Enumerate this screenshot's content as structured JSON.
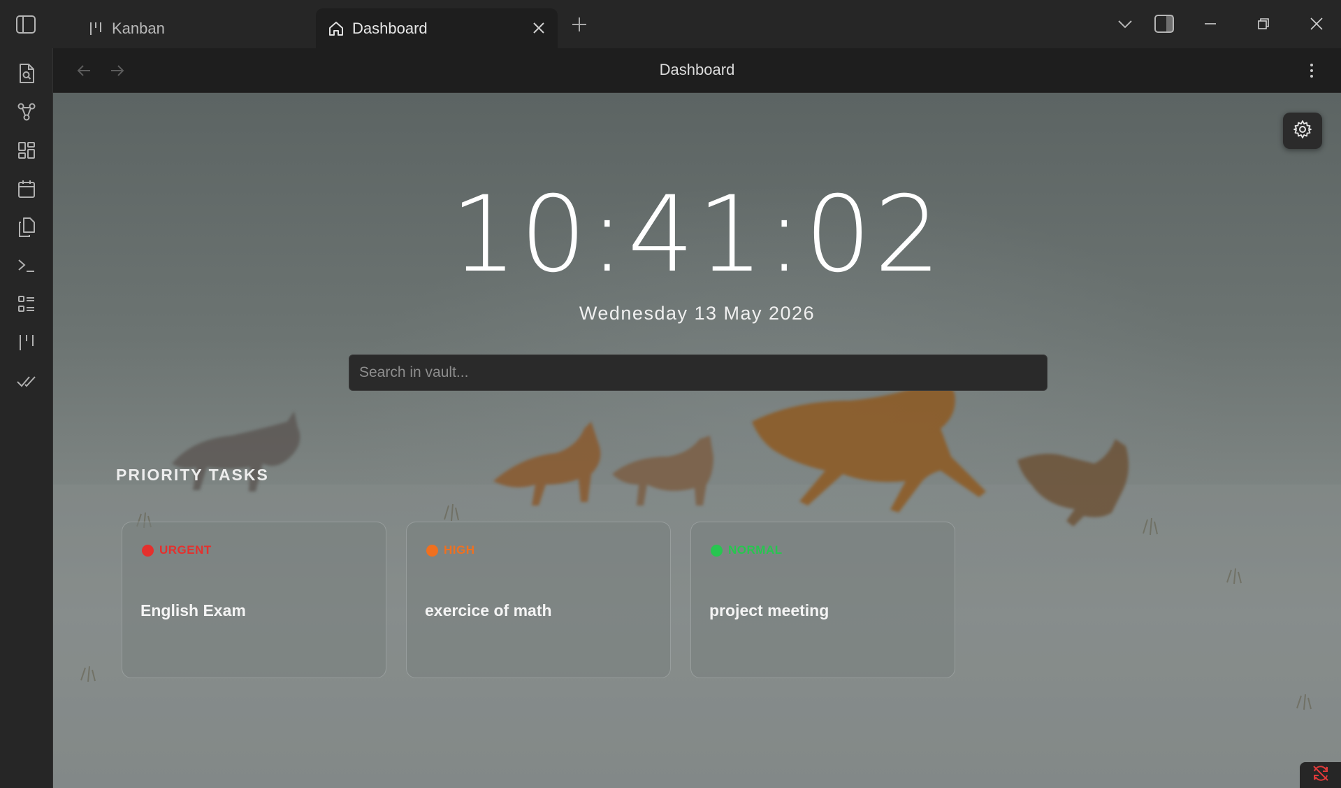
{
  "titlebar": {
    "tabs": [
      {
        "label": "Kanban",
        "icon": "kanban-icon",
        "active": false
      },
      {
        "label": "Dashboard",
        "icon": "home-icon",
        "active": true
      }
    ]
  },
  "ribbon": {
    "items": [
      "file-search-icon",
      "graph-icon",
      "grid-icon",
      "calendar-icon",
      "copy-icon",
      "terminal-icon",
      "list-icon",
      "kanban-icon",
      "check-icon"
    ]
  },
  "header": {
    "title": "Dashboard"
  },
  "dashboard": {
    "clock": "10:41:02",
    "date": "Wednesday 13 May 2026",
    "search_placeholder": "Search in vault...",
    "section_title": "PRIORITY TASKS",
    "tasks": [
      {
        "priority": "URGENT",
        "title": "English Exam",
        "color": "#e5302d"
      },
      {
        "priority": "HIGH",
        "title": "exercice of math",
        "color": "#f0701f"
      },
      {
        "priority": "NORMAL",
        "title": "project meeting",
        "color": "#27c650"
      }
    ]
  },
  "colors": {
    "titlebar_bg": "#262626",
    "content_bg": "#1e1e1e",
    "accent_urgent": "#e5302d",
    "accent_high": "#f0701f",
    "accent_normal": "#27c650",
    "sync_error": "#e03a3a"
  }
}
